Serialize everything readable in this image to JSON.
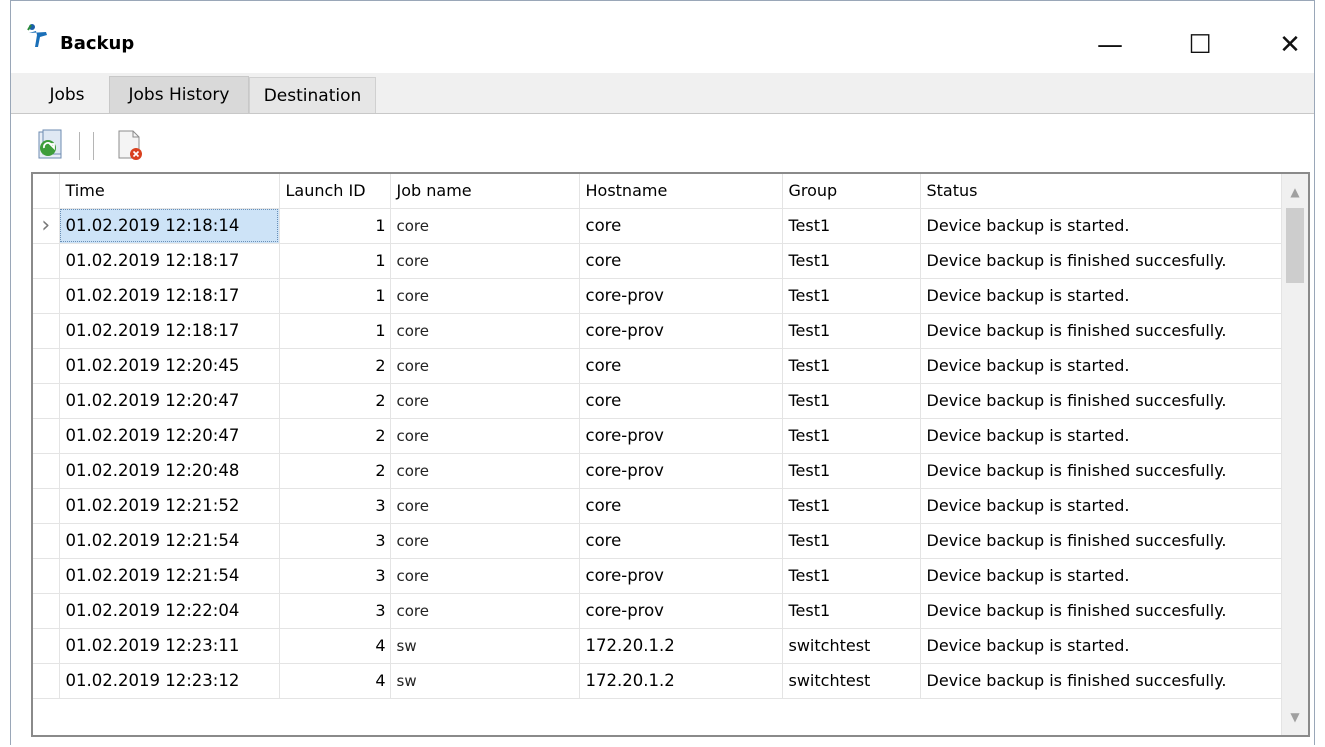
{
  "window": {
    "title": "Backup",
    "icon": "backup-app-icon"
  },
  "window_controls": {
    "minimize": "—",
    "maximize": "☐",
    "close": "✕"
  },
  "tabs": [
    {
      "label": "Jobs",
      "active": false
    },
    {
      "label": "Jobs History",
      "active": true
    },
    {
      "label": "Destination",
      "active": false
    }
  ],
  "toolbar": {
    "refresh_icon": "refresh-icon",
    "clear_icon": "clear-history-icon"
  },
  "grid": {
    "columns": [
      "Time",
      "Launch ID",
      "Job name",
      "Hostname",
      "Group",
      "Status"
    ],
    "selected_row": 0,
    "rows": [
      {
        "time": "01.02.2019 12:18:14",
        "launch_id": "1",
        "job": "core",
        "host": "core",
        "group": "Test1",
        "status": "Device backup is started."
      },
      {
        "time": "01.02.2019 12:18:17",
        "launch_id": "1",
        "job": "core",
        "host": "core",
        "group": "Test1",
        "status": "Device backup is finished succesfully."
      },
      {
        "time": "01.02.2019 12:18:17",
        "launch_id": "1",
        "job": "core",
        "host": "core-prov",
        "group": "Test1",
        "status": "Device backup is started."
      },
      {
        "time": "01.02.2019 12:18:17",
        "launch_id": "1",
        "job": "core",
        "host": "core-prov",
        "group": "Test1",
        "status": "Device backup is finished succesfully."
      },
      {
        "time": "01.02.2019 12:20:45",
        "launch_id": "2",
        "job": "core",
        "host": "core",
        "group": "Test1",
        "status": "Device backup is started."
      },
      {
        "time": "01.02.2019 12:20:47",
        "launch_id": "2",
        "job": "core",
        "host": "core",
        "group": "Test1",
        "status": "Device backup is finished succesfully."
      },
      {
        "time": "01.02.2019 12:20:47",
        "launch_id": "2",
        "job": "core",
        "host": "core-prov",
        "group": "Test1",
        "status": "Device backup is started."
      },
      {
        "time": "01.02.2019 12:20:48",
        "launch_id": "2",
        "job": "core",
        "host": "core-prov",
        "group": "Test1",
        "status": "Device backup is finished succesfully."
      },
      {
        "time": "01.02.2019 12:21:52",
        "launch_id": "3",
        "job": "core",
        "host": "core",
        "group": "Test1",
        "status": "Device backup is started."
      },
      {
        "time": "01.02.2019 12:21:54",
        "launch_id": "3",
        "job": "core",
        "host": "core",
        "group": "Test1",
        "status": "Device backup is finished succesfully."
      },
      {
        "time": "01.02.2019 12:21:54",
        "launch_id": "3",
        "job": "core",
        "host": "core-prov",
        "group": "Test1",
        "status": "Device backup is started."
      },
      {
        "time": "01.02.2019 12:22:04",
        "launch_id": "3",
        "job": "core",
        "host": "core-prov",
        "group": "Test1",
        "status": "Device backup is finished succesfully."
      },
      {
        "time": "01.02.2019 12:23:11",
        "launch_id": "4",
        "job": "sw",
        "host": "172.20.1.2",
        "group": "switchtest",
        "status": "Device backup is started."
      },
      {
        "time": "01.02.2019 12:23:12",
        "launch_id": "4",
        "job": "sw",
        "host": "172.20.1.2",
        "group": "switchtest",
        "status": "Device backup is finished succesfully."
      }
    ]
  },
  "scrollbar": {
    "up": "▲",
    "down": "▼"
  }
}
